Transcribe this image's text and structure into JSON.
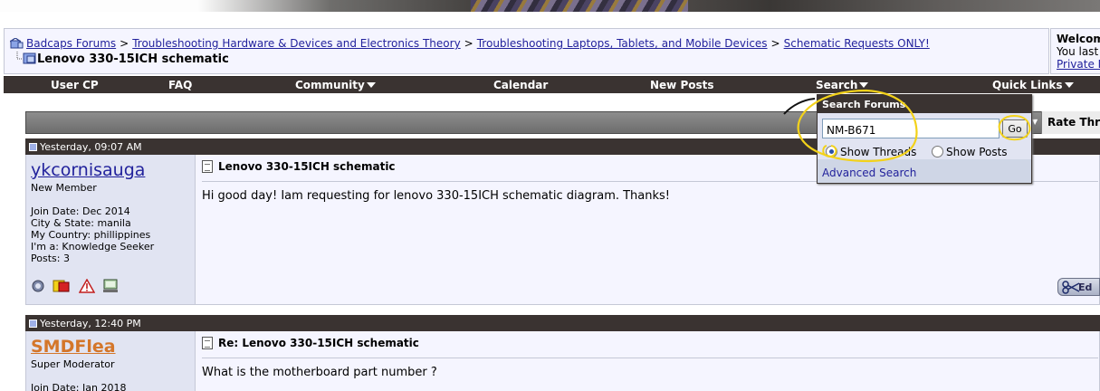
{
  "breadcrumb": {
    "items": [
      "Badcaps Forums",
      "Troubleshooting Hardware & Devices and Electronics Theory",
      "Troubleshooting Laptops, Tablets, and Mobile Devices",
      "Schematic Requests ONLY!"
    ],
    "separator": ">",
    "current": "Lenovo 330-15ICH schematic"
  },
  "welcome": {
    "title": "Welcom",
    "line2": "You last",
    "link": "Private M"
  },
  "mainnav": {
    "items": [
      "User CP",
      "FAQ",
      "Community",
      "Calendar",
      "New Posts",
      "Search",
      "Quick Links"
    ]
  },
  "thread_header": {
    "rate": "Rate Threa"
  },
  "search_popup": {
    "title": "Search Forums",
    "query": "NM-B671",
    "go_label": "Go",
    "show_threads": "Show Threads",
    "show_posts": "Show Posts",
    "selected": "Show Threads",
    "advanced": "Advanced Search"
  },
  "posts": [
    {
      "date": "Yesterday, 09:07 AM",
      "username": "ykcornisauga",
      "usertitle": "New Member",
      "info": [
        "Join Date: Dec 2014",
        "City & State: manila",
        "My Country: phillippines",
        "I'm a: Knowledge Seeker",
        "Posts: 3"
      ],
      "title": "Lenovo 330-15ICH schematic",
      "message": "Hi good day! Iam requesting for lenovo 330-15ICH schematic diagram. Thanks!",
      "edit_label": "Ed"
    },
    {
      "date": "Yesterday, 12:40 PM",
      "username": "SMDFlea",
      "usertitle": "Super Moderator",
      "info": [
        "Join Date: Jan 2018"
      ],
      "title": "Re: Lenovo 330-15ICH schematic",
      "message": "What is the motherboard part number ?"
    }
  ],
  "colors": {
    "nav_bg": "#3a3331",
    "link": "#22229c",
    "moderator": "#d4762a",
    "annotation": "#f3d21a"
  }
}
